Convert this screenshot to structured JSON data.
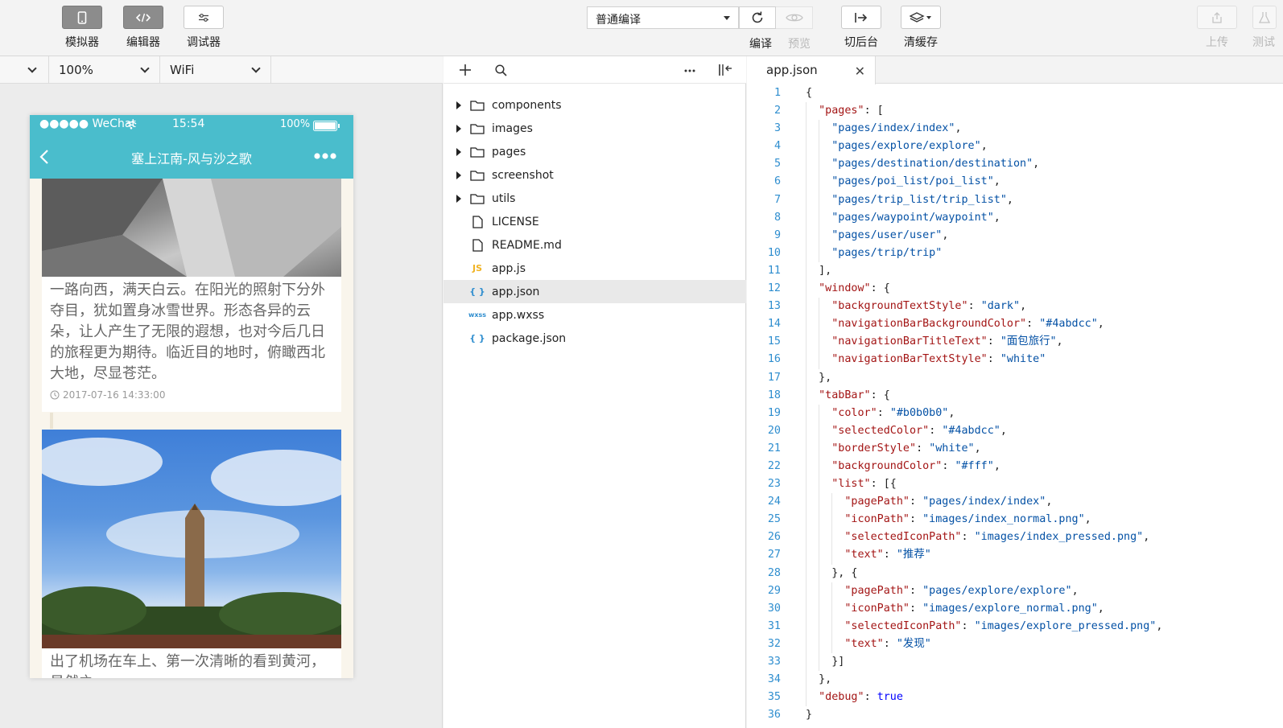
{
  "toolbar": {
    "simulator_label": "模拟器",
    "editor_label": "编辑器",
    "debugger_label": "调试器",
    "compile_mode": "普通编译",
    "compile_label": "编译",
    "preview_label": "预览",
    "background_label": "切后台",
    "clear_cache_label": "清缓存",
    "upload_label": "上传",
    "test_label": "测试"
  },
  "simulator": {
    "zoom": "100%",
    "network": "WiFi",
    "status": {
      "carrier": "●●●●● WeChat",
      "time": "15:54",
      "battery": "100%"
    },
    "nav_title": "塞上江南-风与沙之歌",
    "cards": [
      {
        "text": "一路向西，满天白云。在阳光的照射下分外夺目，犹如置身冰雪世界。形态各异的云朵，让人产生了无限的遐想，也对今后几日的旅程更为期待。临近目的地时，俯瞰西北大地，尽显苍茫。",
        "time": "2017-07-16 14:33:00"
      },
      {
        "text": "出了机场在车上、第一次清晰的看到黄河，虽然之"
      }
    ]
  },
  "file_tree": {
    "items": [
      {
        "name": "components",
        "type": "folder"
      },
      {
        "name": "images",
        "type": "folder"
      },
      {
        "name": "pages",
        "type": "folder"
      },
      {
        "name": "screenshot",
        "type": "folder"
      },
      {
        "name": "utils",
        "type": "folder"
      },
      {
        "name": "LICENSE",
        "type": "file"
      },
      {
        "name": "README.md",
        "type": "file"
      },
      {
        "name": "app.js",
        "type": "js",
        "badge": "JS"
      },
      {
        "name": "app.json",
        "type": "json",
        "badge": "{ }",
        "selected": true
      },
      {
        "name": "app.wxss",
        "type": "wxss",
        "badge": "wxss"
      },
      {
        "name": "package.json",
        "type": "json",
        "badge": "{ }"
      }
    ]
  },
  "editor": {
    "tab_name": "app.json",
    "lines": [
      "{",
      "  \"pages\": [",
      "    \"pages/index/index\",",
      "    \"pages/explore/explore\",",
      "    \"pages/destination/destination\",",
      "    \"pages/poi_list/poi_list\",",
      "    \"pages/trip_list/trip_list\",",
      "    \"pages/waypoint/waypoint\",",
      "    \"pages/user/user\",",
      "    \"pages/trip/trip\"",
      "  ],",
      "  \"window\": {",
      "    \"backgroundTextStyle\": \"dark\",",
      "    \"navigationBarBackgroundColor\": \"#4abdcc\",",
      "    \"navigationBarTitleText\": \"面包旅行\",",
      "    \"navigationBarTextStyle\": \"white\"",
      "  },",
      "  \"tabBar\": {",
      "    \"color\": \"#b0b0b0\",",
      "    \"selectedColor\": \"#4abdcc\",",
      "    \"borderStyle\": \"white\",",
      "    \"backgroundColor\": \"#fff\",",
      "    \"list\": [{",
      "      \"pagePath\": \"pages/index/index\",",
      "      \"iconPath\": \"images/index_normal.png\",",
      "      \"selectedIconPath\": \"images/index_pressed.png\",",
      "      \"text\": \"推荐\"",
      "    }, {",
      "      \"pagePath\": \"pages/explore/explore\",",
      "      \"iconPath\": \"images/explore_normal.png\",",
      "      \"selectedIconPath\": \"images/explore_pressed.png\",",
      "      \"text\": \"发现\"",
      "    }]",
      "  },",
      "  \"debug\": true",
      "}"
    ]
  },
  "colors": {
    "accent": "#4abdcc",
    "code_key": "#a31515",
    "code_string": "#0451a5",
    "line_number": "#2f8ecf"
  }
}
